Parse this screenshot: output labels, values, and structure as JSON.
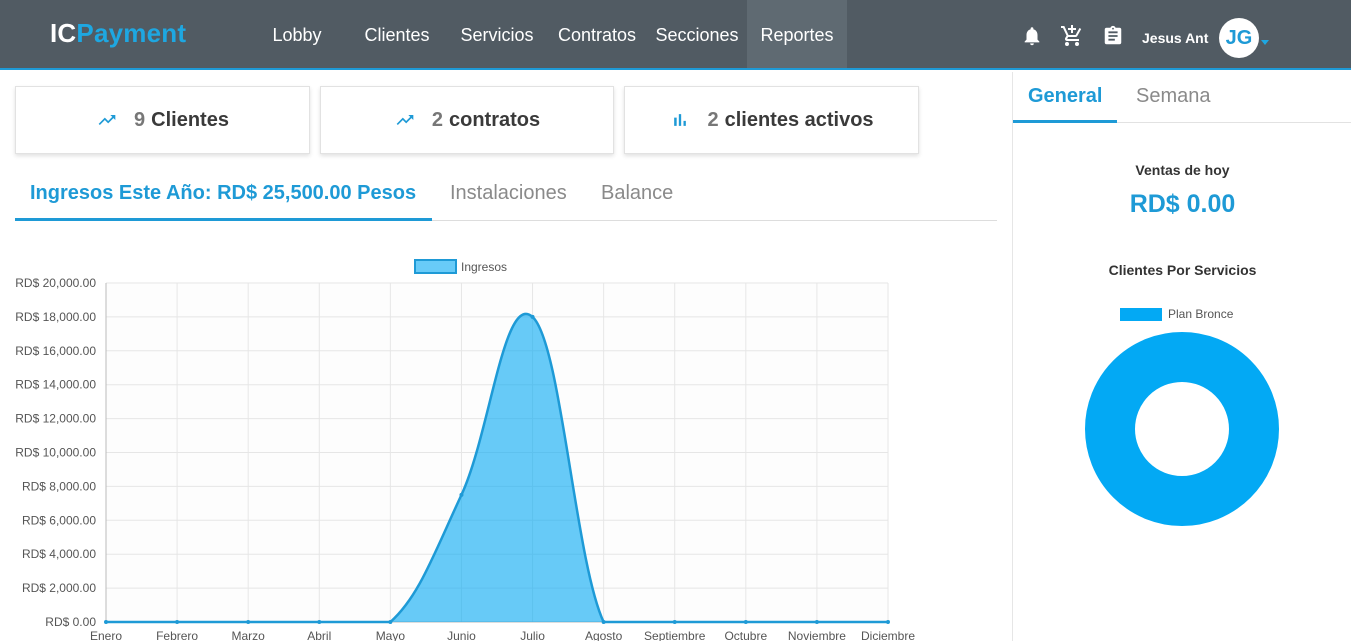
{
  "brand": {
    "part1": "IC",
    "part2": "Payment"
  },
  "nav": [
    "Lobby",
    "Clientes",
    "Servicios",
    "Contratos",
    "Secciones",
    "Reportes"
  ],
  "nav_active": "Reportes",
  "header": {
    "user_name": "Jesus Ant",
    "initials": "JG"
  },
  "stats": [
    {
      "num": "9",
      "label": "Clientes",
      "icon": "trending-up-icon"
    },
    {
      "num": "2",
      "label": "contratos",
      "icon": "trending-up-icon"
    },
    {
      "num": "2",
      "label": "clientes activos",
      "icon": "bar-chart-icon"
    }
  ],
  "tabs": [
    "Ingresos Este Año: RD$ 25,500.00 Pesos",
    "Instalaciones",
    "Balance"
  ],
  "side": {
    "tabs": [
      "General",
      "Semana"
    ],
    "sales_label": "Ventas de hoy",
    "sales_value": "RD$ 0.00",
    "clients_per_service_label": "Clientes Por Servicios"
  },
  "colors": {
    "accent": "#1e9ad6",
    "topbar": "#515b63",
    "series": "#03a9f4"
  },
  "chart_data": [
    {
      "type": "area",
      "categories": [
        "Enero",
        "Febrero",
        "Marzo",
        "Abril",
        "Mayo",
        "Junio",
        "Julio",
        "Agosto",
        "Septiembre",
        "Octubre",
        "Noviembre",
        "Diciembre"
      ],
      "series": [
        {
          "name": "Ingresos",
          "values": [
            0,
            0,
            0,
            0,
            0,
            7500,
            18000,
            0,
            0,
            0,
            0,
            0
          ]
        }
      ],
      "ylim": [
        0,
        20000
      ],
      "yticks": [
        "RD$ 20,000.00",
        "RD$ 18,000.00",
        "RD$ 16,000.00",
        "RD$ 14,000.00",
        "RD$ 12,000.00",
        "RD$ 10,000.00",
        "RD$ 8,000.00",
        "RD$ 6,000.00",
        "RD$ 4,000.00",
        "RD$ 2,000.00",
        "RD$ 0.00"
      ],
      "legend": "top",
      "grid": true
    },
    {
      "type": "pie",
      "categories": [
        "Plan Bronce"
      ],
      "values": [
        1
      ],
      "legend": "top"
    }
  ]
}
